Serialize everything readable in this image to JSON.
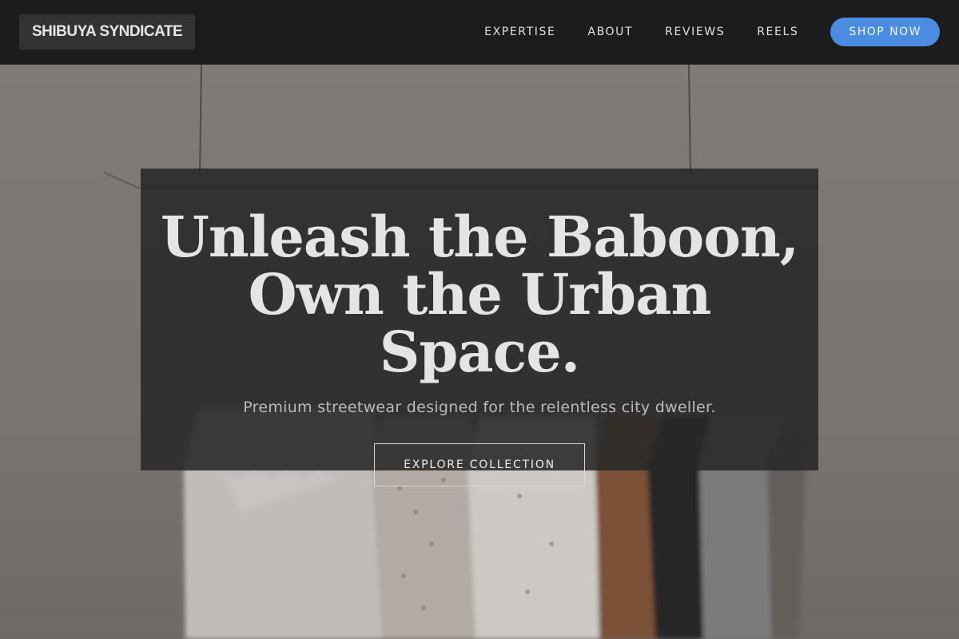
{
  "brand": {
    "name": "SHIBUYA SYNDICATE"
  },
  "nav": {
    "items": [
      {
        "label": "EXPERTISE"
      },
      {
        "label": "ABOUT"
      },
      {
        "label": "REVIEWS"
      },
      {
        "label": "REELS"
      }
    ],
    "shop_label": "SHOP NOW"
  },
  "hero": {
    "headline_line1": "Unleash the Baboon,",
    "headline_line2": "Own the Urban Space.",
    "subtitle": "Premium streetwear designed for the relentless city dweller.",
    "cta_label": "EXPLORE COLLECTION"
  },
  "colors": {
    "header_bg": "#1c1c1c",
    "accent": "#4a8de0",
    "panel_bg": "#282828"
  }
}
